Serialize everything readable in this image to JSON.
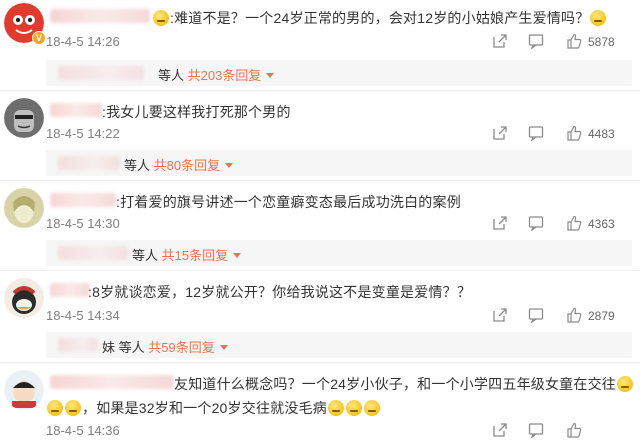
{
  "comments": [
    {
      "text": ":难道不是？一个24岁正常的男的，会对12岁的小姑娘产生爱情吗？",
      "time": "18-4-5 14:26",
      "likes": "5878",
      "reply_suffix": "等人",
      "reply_link": "共203条回复"
    },
    {
      "text": ":我女儿要这样我打死那个男的",
      "time": "18-4-5 14:22",
      "likes": "4483",
      "reply_suffix": "等人",
      "reply_link": "共80条回复"
    },
    {
      "text": ":打着爱的旗号讲述一个恋童癖变态最后成功洗白的案例",
      "time": "18-4-5 14:30",
      "likes": "4363",
      "reply_suffix": "等人",
      "reply_link": "共15条回复"
    },
    {
      "text": ":8岁就谈恋爱，12岁就公开？你给我说这不是变童是爱情？？",
      "time": "18-4-5 14:34",
      "likes": "2879",
      "reply_suffix": "妹 等人",
      "reply_link": "共59条回复"
    },
    {
      "text_line1": "友知道什么概念吗？一个24岁小伙子，和一个小学四五年级女童在交往",
      "text_line2": "，如果是32岁和一个20岁交往就没毛病",
      "time": "18-4-5 14:36",
      "likes": ""
    }
  ],
  "icons": {
    "share": "share-icon",
    "comment": "comment-icon",
    "like": "thumbs-up-icon"
  },
  "colors": {
    "accent": "#eb7350",
    "time": "#808080"
  }
}
